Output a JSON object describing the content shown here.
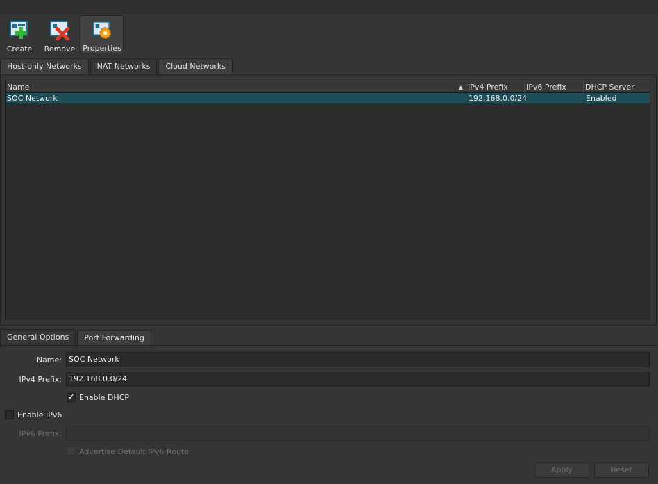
{
  "toolbar": {
    "create_label": "Create",
    "remove_label": "Remove",
    "properties_label": "Properties"
  },
  "top_tabs": [
    {
      "label": "Host-only Networks",
      "active": false
    },
    {
      "label": "NAT Networks",
      "active": true
    },
    {
      "label": "Cloud Networks",
      "active": false
    }
  ],
  "table": {
    "columns": [
      "Name",
      "IPv4 Prefix",
      "IPv6 Prefix",
      "DHCP Server"
    ],
    "rows": [
      {
        "name": "SOC Network",
        "ipv4": "192.168.0.0/24",
        "ipv6": "",
        "dhcp": "Enabled"
      }
    ]
  },
  "bottom_tabs": [
    {
      "label": "General Options",
      "active": true
    },
    {
      "label": "Port Forwarding",
      "active": false
    }
  ],
  "form": {
    "name_label": "Name:",
    "name_value": "SOC Network",
    "ipv4_label": "IPv4 Prefix:",
    "ipv4_value": "192.168.0.0/24",
    "enable_dhcp_label": "Enable DHCP",
    "enable_dhcp_checked": true,
    "enable_ipv6_label": "Enable IPv6",
    "enable_ipv6_checked": false,
    "ipv6_label": "IPv6 Prefix:",
    "ipv6_value": "",
    "advertise_label": "Advertise Default IPv6 Route",
    "advertise_checked": false
  },
  "buttons": {
    "apply_label": "Apply",
    "reset_label": "Reset"
  },
  "colors": {
    "background": "#353535",
    "selection": "#1e4d57",
    "text": "#e6e6e6",
    "disabled_text": "#6e6e6e"
  }
}
